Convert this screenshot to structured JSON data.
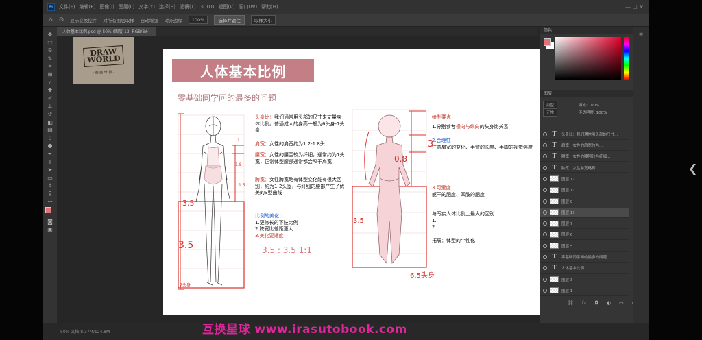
{
  "menubar": {
    "logo": "Ps",
    "items": [
      "文件(F)",
      "编辑(E)",
      "图像(I)",
      "图层(L)",
      "文字(Y)",
      "选择(S)",
      "滤镜(T)",
      "3D(D)",
      "视图(V)",
      "窗口(W)",
      "帮助(H)"
    ]
  },
  "options": {
    "items": [
      "显示变换控件",
      "对所有图层取样",
      "自动增强",
      "对齐边缘",
      "100%",
      "选择并遮住"
    ],
    "sample": "取样大小"
  },
  "tabs": [
    "人体基本比例.psd @ 50% (图层 13, RGB/8#)"
  ],
  "logo": {
    "line1": "DRAW",
    "line2": "WORLD",
    "sub": "· 画 画 世 界 ·"
  },
  "doc": {
    "title": "人体基本比例",
    "subtitle": "零基础同学问的最多的问题",
    "left_notes": {
      "head_label": "头身比：",
      "head_text": "我们通常用头部的尺寸来丈量身体比例。普通成人的身高一般为6头身-7头身",
      "shoulder_label": "肩宽：",
      "shoulder_text": "女性的肩宽约为1.2-1.8头",
      "waist_label": "腰宽：",
      "waist_text": "女性的腰围较为纤细，通常约为1头宽，正常体型腰部通常都会窄于肩宽",
      "hip_label": "胯宽：",
      "hip_text": "女性胯宽略有体型变化能有很大区别，约为1-2头宽，与纤细的腰部产生了优美的S型曲线",
      "beauty_label": "比例的美化：",
      "beauty_1": "1.更修长的下肢比例",
      "beauty_2": "2.胯宽比差距更大",
      "beauty_3": "3.美化要适度",
      "ratio": "3.5 : 3.5  1:1"
    },
    "right_notes": {
      "key_label": "绘制要点",
      "p1_pre": "1.分别参考",
      "p1_hl": "横向与纵向",
      "p1_post": "的头身比关系",
      "p2_label": "2.合理性",
      "p2_text": "注意肩宽的变化、手臂的长度、手脚的视觉强度",
      "p3_label": "3.可爱度",
      "p3_text": "躯干的肥度、四肢的肥度",
      "compare": "与写实人体比例上最大的区别",
      "c1": "1.",
      "c2": "2.",
      "expand": "拓展：体型的个性化"
    },
    "fig_left": {
      "m1": "1",
      "m15": "1.5",
      "m18": "1.8",
      "m35a": "3.5",
      "m35b": "3.5",
      "bottom": "7头身"
    },
    "fig_right": {
      "m08": "0.8",
      "m3": "3",
      "m35": "3.5",
      "bottom": "6.5头身"
    }
  },
  "right_panel": {
    "color_head": "颜色",
    "layers_head": "图层",
    "blend": "正常",
    "opacity": "不透明度: 100%",
    "fill": "填充: 100%",
    "layers": [
      {
        "type": "text",
        "name": "头身比：我们通常用头部的尺寸..."
      },
      {
        "type": "text",
        "name": "肩宽：女性的肩宽约为..."
      },
      {
        "type": "text",
        "name": "腰宽：女性的腰围较为纤细..."
      },
      {
        "type": "text",
        "name": "胯宽：女性胯宽略有..."
      },
      {
        "type": "pixel",
        "name": "图层 12"
      },
      {
        "type": "pixel",
        "name": "图层 11"
      },
      {
        "type": "pixel",
        "name": "图层 9"
      },
      {
        "type": "pixel",
        "name": "图层 13"
      },
      {
        "type": "pixel",
        "name": "图层 7"
      },
      {
        "type": "pixel",
        "name": "图层 6"
      },
      {
        "type": "pixel",
        "name": "图层 5"
      },
      {
        "type": "text",
        "name": "零基础同学问的最多的问题"
      },
      {
        "type": "text",
        "name": "人体基本比例"
      },
      {
        "type": "pixel",
        "name": "图层 3"
      },
      {
        "type": "pixel",
        "name": "图层 1"
      }
    ]
  },
  "status": "50%    文档:8.37M/124.8M",
  "watermark": "互换星球 www.irasutobook.com",
  "colors": {
    "accent": "#c47f86",
    "red": "#c0392b",
    "watermark": "#e0249c",
    "swatch_fg": "#e2737d"
  }
}
